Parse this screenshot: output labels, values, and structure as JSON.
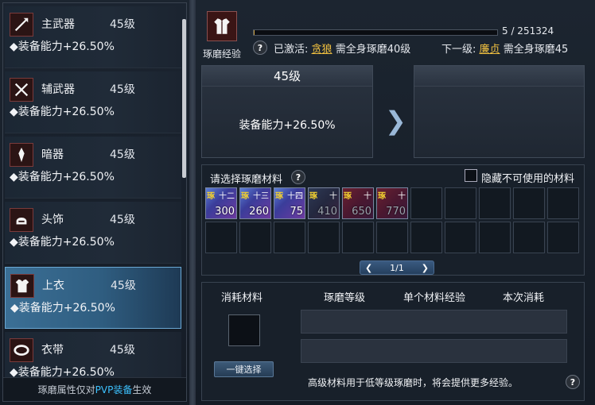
{
  "slots": [
    {
      "name": "主武器",
      "level": "45级",
      "attr": "◆装备能力+26.50%",
      "icon": "spear-icon",
      "selected": false
    },
    {
      "name": "辅武器",
      "level": "45级",
      "attr": "◆装备能力+26.50%",
      "icon": "crossed-swords-icon",
      "selected": false
    },
    {
      "name": "暗器",
      "level": "45级",
      "attr": "◆装备能力+26.50%",
      "icon": "dart-icon",
      "selected": false
    },
    {
      "name": "头饰",
      "level": "45级",
      "attr": "◆装备能力+26.50%",
      "icon": "helmet-icon",
      "selected": false
    },
    {
      "name": "上衣",
      "level": "45级",
      "attr": "◆装备能力+26.50%",
      "icon": "armor-icon",
      "selected": true
    },
    {
      "name": "衣带",
      "level": "45级",
      "attr": "◆装备能力+26.50%",
      "icon": "belt-icon",
      "selected": false
    }
  ],
  "footer": {
    "prefix": "琢磨属性仅对",
    "pvp": "PVP装备",
    "suffix": "生效"
  },
  "header": {
    "icon": "armor-icon",
    "label": "琢磨经验",
    "progress_text": "5 / 251324",
    "progress": 0.0002,
    "activated_label": "已激活:",
    "activated_name": "贪狼",
    "activated_req": "需全身琢磨40级",
    "next_label": "下一级:",
    "next_name": "廉贞",
    "next_req": "需全身琢磨45"
  },
  "current": {
    "level": "45级",
    "attr": "装备能力+26.50%"
  },
  "materials": {
    "title": "请选择琢磨材料",
    "hide_label": "隐藏不可使用的材料",
    "items": [
      {
        "count": "300",
        "rank": "十二",
        "style": "blue"
      },
      {
        "count": "260",
        "rank": "十三",
        "style": "blue"
      },
      {
        "count": "75",
        "rank": "十四",
        "style": "blue"
      },
      {
        "count": "410",
        "rank": "十",
        "style": "dim"
      },
      {
        "count": "650",
        "rank": "十",
        "style": "red"
      },
      {
        "count": "770",
        "rank": "十",
        "style": "red"
      }
    ],
    "page": "1/1"
  },
  "consume": {
    "col1": "消耗材料",
    "col2": "琢磨等级",
    "col3": "单个材料经验",
    "col4": "本次消耗",
    "button": "一键选择",
    "note": "高级材料用于低等级琢磨时，将会提供更多经验。"
  }
}
